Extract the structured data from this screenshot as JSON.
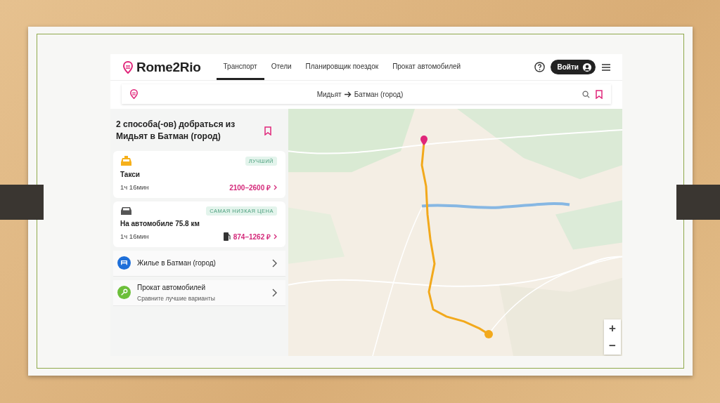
{
  "header": {
    "logo": "Rome2Rio",
    "nav": [
      {
        "label": "Транспорт",
        "selected": true
      },
      {
        "label": "Отели",
        "selected": false
      },
      {
        "label": "Планировщик поездок",
        "selected": false
      },
      {
        "label": "Прокат автомобилей",
        "selected": false
      }
    ],
    "login": "Войти"
  },
  "search": {
    "from": "Мидьят",
    "to": "Батман (город)"
  },
  "results": {
    "title": "2 способа(-ов) добраться из Мидьят в Батман (город)",
    "options": [
      {
        "kind": "taxi",
        "name": "Такси",
        "badge": "ЛУЧШИЙ",
        "duration": "1ч 16мин",
        "price": "2100–2600 ₽"
      },
      {
        "kind": "car",
        "name": "На автомобиле 75.8 км",
        "badge": "САМАЯ НИЗКАЯ ЦЕНА",
        "duration": "1ч 16мин",
        "price": "874–1262 ₽"
      }
    ],
    "links": [
      {
        "kind": "hotel",
        "title": "Жилье в Батман (город)"
      },
      {
        "kind": "rental",
        "title": "Прокат автомобилей",
        "subtitle": "Сравните лучшие варианты"
      }
    ]
  },
  "map": {
    "kind": "picture",
    "zoom_in": "+",
    "zoom_out": "−"
  }
}
